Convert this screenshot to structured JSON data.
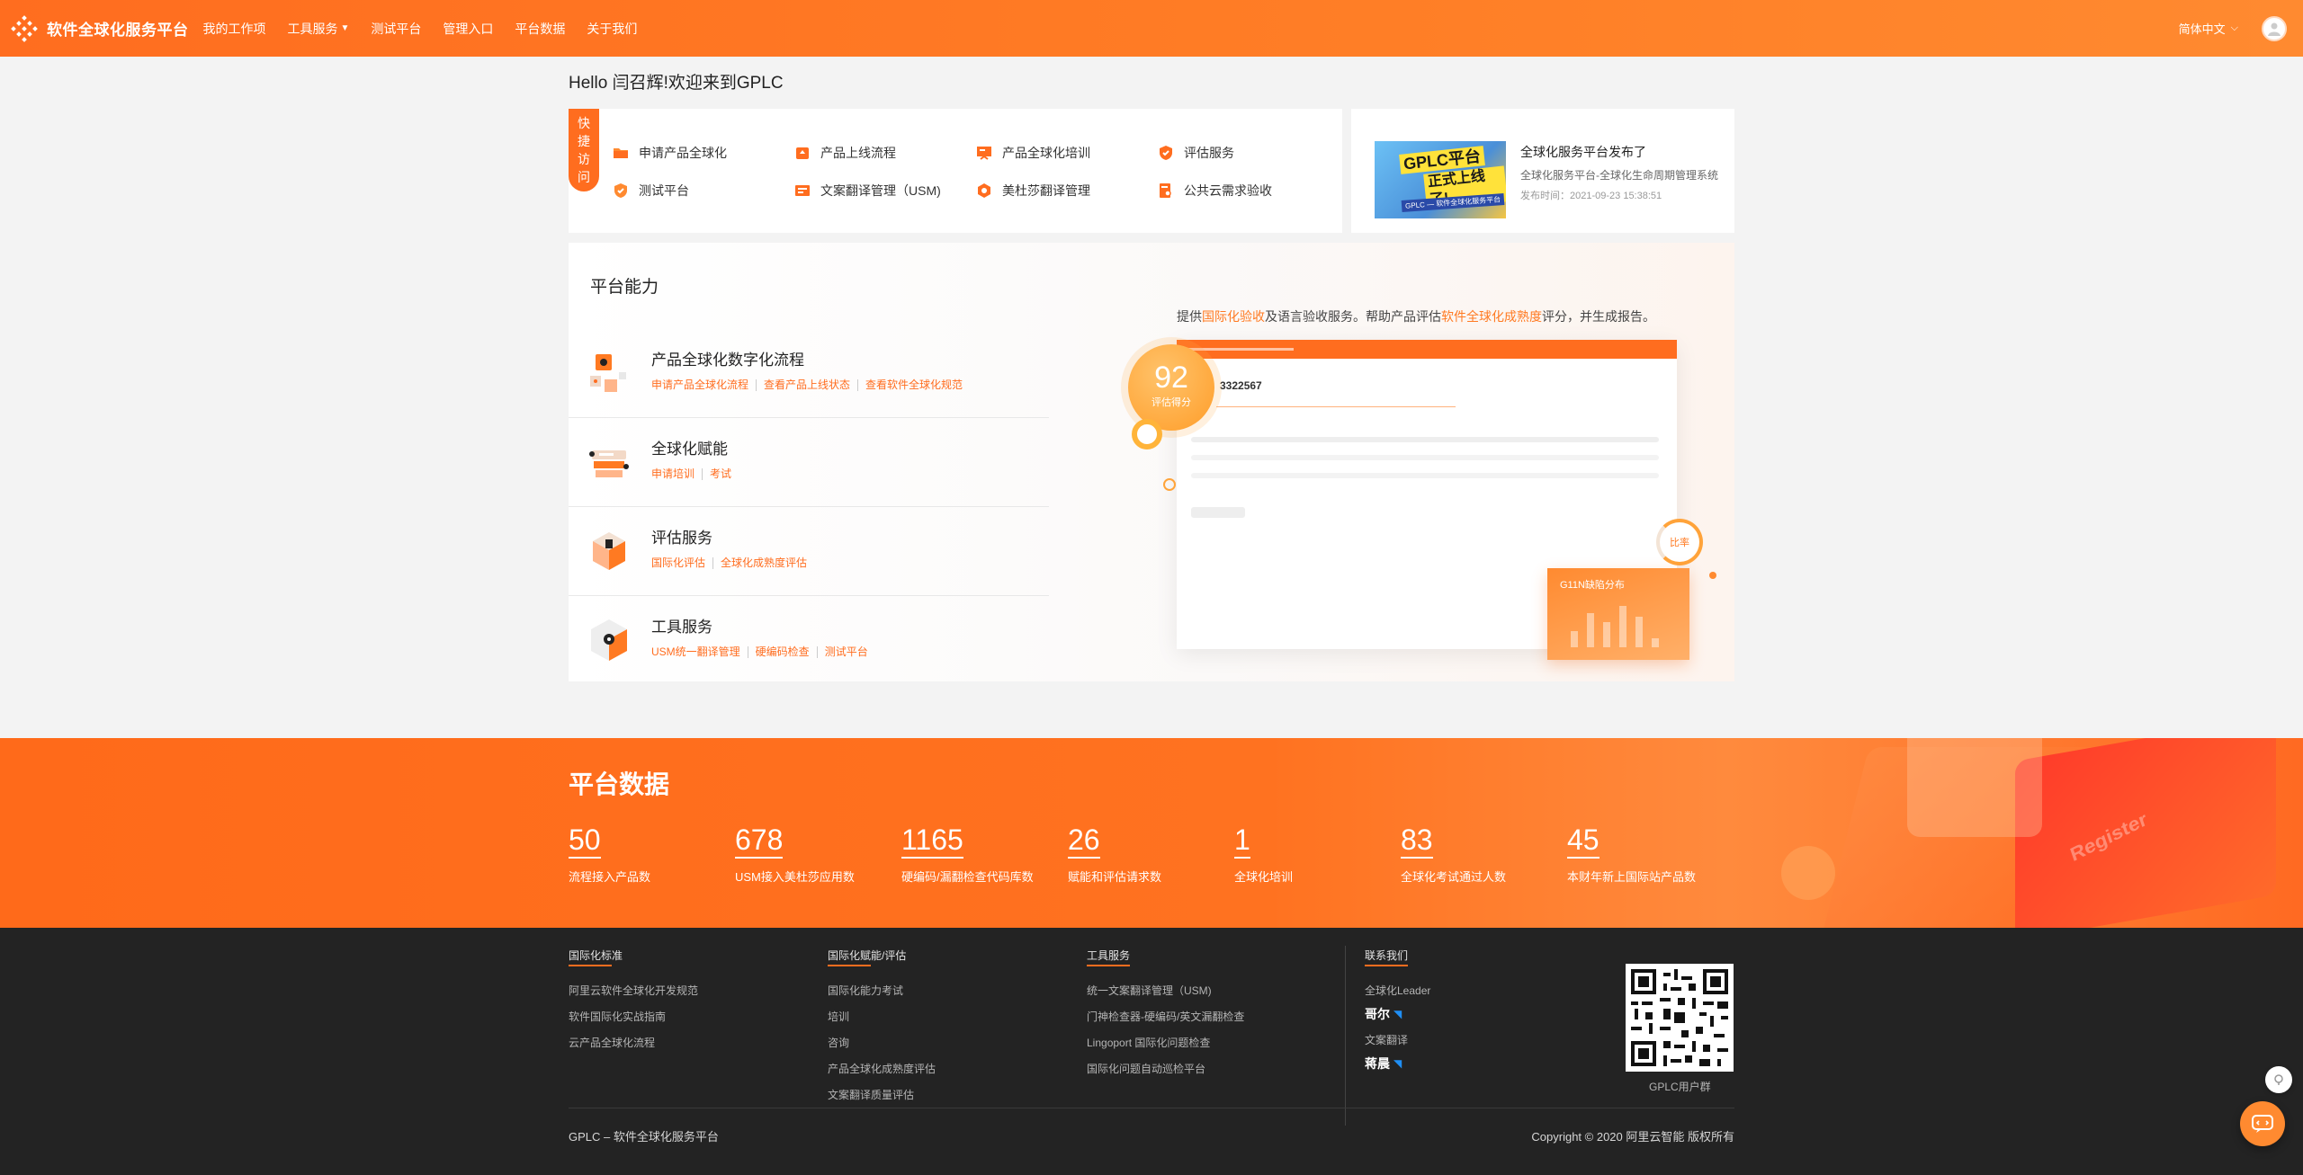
{
  "nav": {
    "brand": "软件全球化服务平台",
    "links": [
      "我的工作项",
      "工具服务",
      "测试平台",
      "管理入口",
      "平台数据",
      "关于我们"
    ],
    "language": "简体中文"
  },
  "greeting": "Hello 闫召辉!欢迎来到GPLC",
  "quick_access": {
    "tag": [
      "快",
      "捷",
      "访",
      "问"
    ],
    "items": [
      "申请产品全球化",
      "产品上线流程",
      "产品全球化培训",
      "评估服务",
      "测试平台",
      "文案翻译管理（USM)",
      "美杜莎翻译管理",
      "公共云需求验收"
    ]
  },
  "news": {
    "thumb_line1": "GPLC平台",
    "thumb_line2": "正式上线了!",
    "thumb_sub": "GPLC — 软件全球化服务平台",
    "title": "全球化服务平台发布了",
    "desc": "全球化服务平台-全球化生命周期管理系统",
    "date": "发布时间：2021-09-23 15:38:51"
  },
  "capability": {
    "title": "平台能力",
    "items": [
      {
        "name": "产品全球化数字化流程",
        "links": [
          "申请产品全球化流程",
          "查看产品上线状态",
          "查看软件全球化规范"
        ]
      },
      {
        "name": "全球化赋能",
        "links": [
          "申请培训",
          "考试"
        ]
      },
      {
        "name": "评估服务",
        "links": [
          "国际化评估",
          "全球化成熟度评估"
        ]
      },
      {
        "name": "工具服务",
        "links": [
          "USM统一翻译管理",
          "硬编码检查",
          "测试平台"
        ]
      }
    ],
    "desc_parts": [
      "提供",
      "国际化验收",
      "及语言验收服务。帮助产品评估",
      "软件全球化成熟度",
      "评分，并生成报告。"
    ],
    "preview_id": "3322567",
    "score": "92",
    "score_label": "评估得分",
    "ratio_label": "比率",
    "g11n_label": "G11N缺陷分布"
  },
  "stats": {
    "title": "平台数据",
    "items": [
      {
        "value": "50",
        "label": "流程接入产品数"
      },
      {
        "value": "678",
        "label": "USM接入美杜莎应用数"
      },
      {
        "value": "1165",
        "label": "硬编码/漏翻检查代码库数"
      },
      {
        "value": "26",
        "label": "赋能和评估请求数"
      },
      {
        "value": "1",
        "label": "全球化培训"
      },
      {
        "value": "83",
        "label": "全球化考试通过人数"
      },
      {
        "value": "45",
        "label": "本财年新上国际站产品数"
      }
    ],
    "deco_word": "Register"
  },
  "footer": {
    "cols": [
      {
        "head": "国际化标准",
        "links": [
          "阿里云软件全球化开发规范",
          "软件国际化实战指南",
          "云产品全球化流程"
        ]
      },
      {
        "head": "国际化赋能/评估",
        "links": [
          "国际化能力考试",
          "培训",
          "咨询",
          "产品全球化成熟度评估",
          "文案翻译质量评估"
        ]
      },
      {
        "head": "工具服务",
        "links": [
          "统一文案翻译管理（USM)",
          "门神检查器-硬编码/英文漏翻检查",
          "Lingoport 国际化问题检查",
          "国际化问题自动巡检平台"
        ]
      }
    ],
    "contact": {
      "head": "联系我们",
      "role1": "全球化Leader",
      "name1": "哥尔",
      "role2": "文案翻译",
      "name2": "蒋晨"
    },
    "qr_label": "GPLC用户群",
    "brand": "GPLC – 软件全球化服务平台",
    "copyright": "Copyright © 2020 阿里云智能 版权所有"
  },
  "colors": {
    "accent": "#ff6d1f",
    "footer_bg": "#232323"
  }
}
